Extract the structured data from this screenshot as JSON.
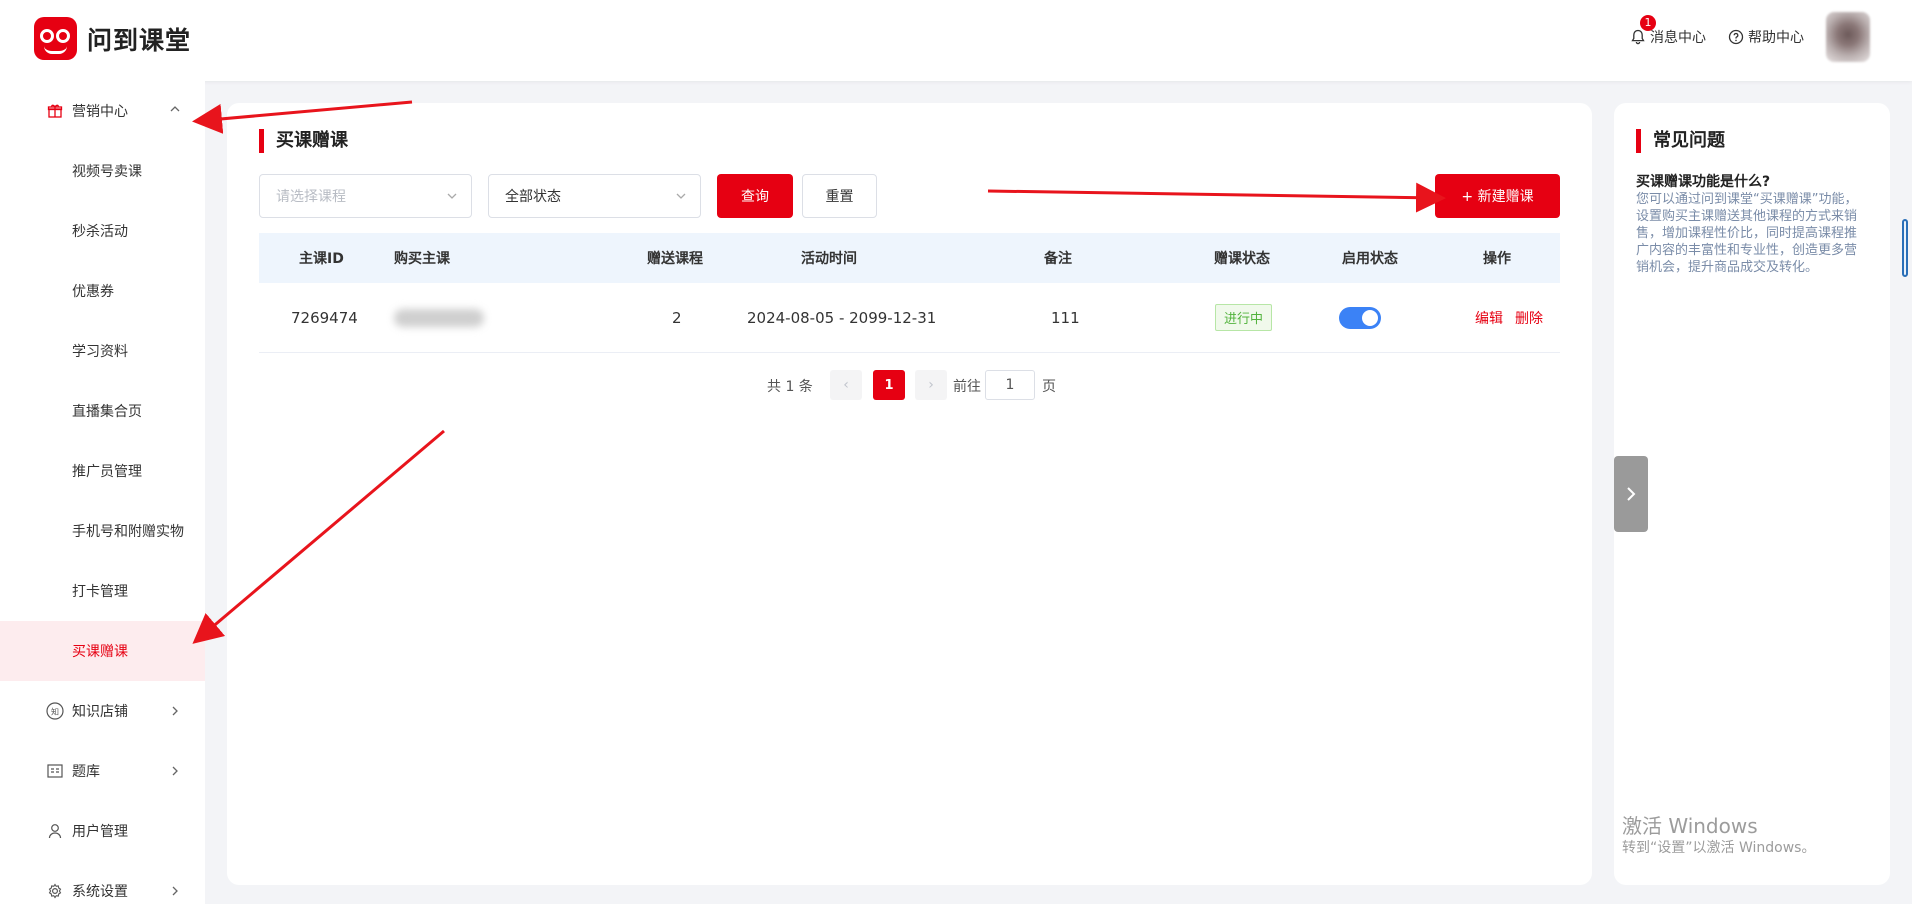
{
  "app": {
    "name": "问到课堂"
  },
  "header": {
    "notifications": {
      "label": "消息中心",
      "badge": "1"
    },
    "help": {
      "label": "帮助中心"
    }
  },
  "sidebar": {
    "items": [
      {
        "label": "营销中心",
        "icon": "gift-icon",
        "expanded": true
      },
      {
        "label": "视频号卖课"
      },
      {
        "label": "秒杀活动"
      },
      {
        "label": "优惠券"
      },
      {
        "label": "学习资料"
      },
      {
        "label": "直播集合页"
      },
      {
        "label": "推广员管理"
      },
      {
        "label": "手机号和附赠实物"
      },
      {
        "label": "打卡管理"
      },
      {
        "label": "买课赠课",
        "active": true
      },
      {
        "label": "知识店铺",
        "icon": "shop-icon"
      },
      {
        "label": "题库",
        "icon": "question-bank-icon"
      },
      {
        "label": "用户管理",
        "icon": "user-icon"
      },
      {
        "label": "系统设置",
        "icon": "settings-icon"
      }
    ]
  },
  "main": {
    "title": "买课赠课",
    "filters": {
      "course_placeholder": "请选择课程",
      "status_value": "全部状态"
    },
    "buttons": {
      "query": "查询",
      "reset": "重置",
      "new": "+ 新建赠课"
    },
    "table": {
      "columns": [
        "主课ID",
        "购买主课",
        "赠送课程",
        "活动时间",
        "备注",
        "赠课状态",
        "启用状态",
        "操作"
      ],
      "rows": [
        {
          "id": "7269474",
          "course": "",
          "gift_count": "2",
          "period": "2024-08-05 - 2099-12-31",
          "note": "111",
          "status": "进行中",
          "enabled": true,
          "actions": {
            "edit": "编辑",
            "delete": "删除"
          }
        }
      ]
    },
    "pagination": {
      "total_text": "共 1 条",
      "current": "1",
      "goto_label": "前往",
      "goto_value": "1",
      "page_suffix": "页"
    }
  },
  "faq": {
    "title": "常见问题",
    "question": "买课赠课功能是什么?",
    "answer": "您可以通过问到课堂“买课赠课”功能，设置购买主课赠送其他课程的方式来销售，增加课程性价比，同时提高课程推广内容的丰富性和专业性，创造更多营销机会，提升商品成交及转化。"
  },
  "watermark": {
    "line1": "激活 Windows",
    "line2": "转到“设置”以激活 Windows。"
  },
  "colors": {
    "brand": "#e60012",
    "toggle": "#3b82f6",
    "status_green": "#52b33d"
  }
}
